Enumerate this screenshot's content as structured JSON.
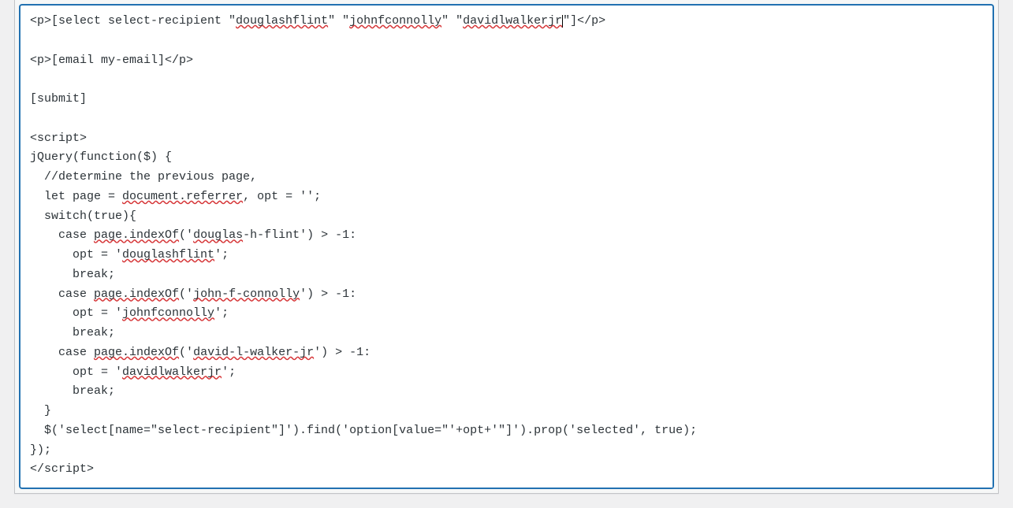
{
  "editor": {
    "line1_prefix": "<p>[select select-recipient \"",
    "line1_s1": "douglashflint",
    "line1_mid1": "\" \"",
    "line1_s2": "johnfconnolly",
    "line1_mid2": "\" \"",
    "line1_s3": "davidlwalkerjr",
    "line1_suffix": "\"]</p>",
    "line3": "<p>[email my-email]</p>",
    "line5": "[submit]",
    "line7": "<script>",
    "line8": "jQuery(function($) {",
    "line9": "  //determine the previous page,",
    "line10_a": "  let page = ",
    "line10_b": "document.referrer",
    "line10_c": ", opt = '';",
    "line11": "  switch(true){",
    "line12_a": "    case ",
    "line12_b": "page.indexOf",
    "line12_c": "('",
    "line12_d": "douglas",
    "line12_e": "-h-flint') > -1:",
    "line13_a": "      opt = '",
    "line13_b": "douglashflint",
    "line13_c": "';",
    "line14": "      break;",
    "line15_a": "    case ",
    "line15_b": "page.indexOf",
    "line15_c": "('",
    "line15_d": "john-f-connolly",
    "line15_e": "') > -1:",
    "line16_a": "      opt = '",
    "line16_b": "johnfconnolly",
    "line16_c": "';",
    "line17": "      break;",
    "line18_a": "    case ",
    "line18_b": "page.indexOf",
    "line18_c": "('",
    "line18_d": "david-l-walker-jr",
    "line18_e": "') > -1:",
    "line19_a": "      opt = '",
    "line19_b": "davidlwalkerjr",
    "line19_c": "';",
    "line20": "      break;",
    "line21": "  }",
    "line22": "  $('select[name=\"select-recipient\"]').find('option[value=\"'+opt+'\"]').prop('selected', true);",
    "line23": "});",
    "line24": "</script>"
  }
}
